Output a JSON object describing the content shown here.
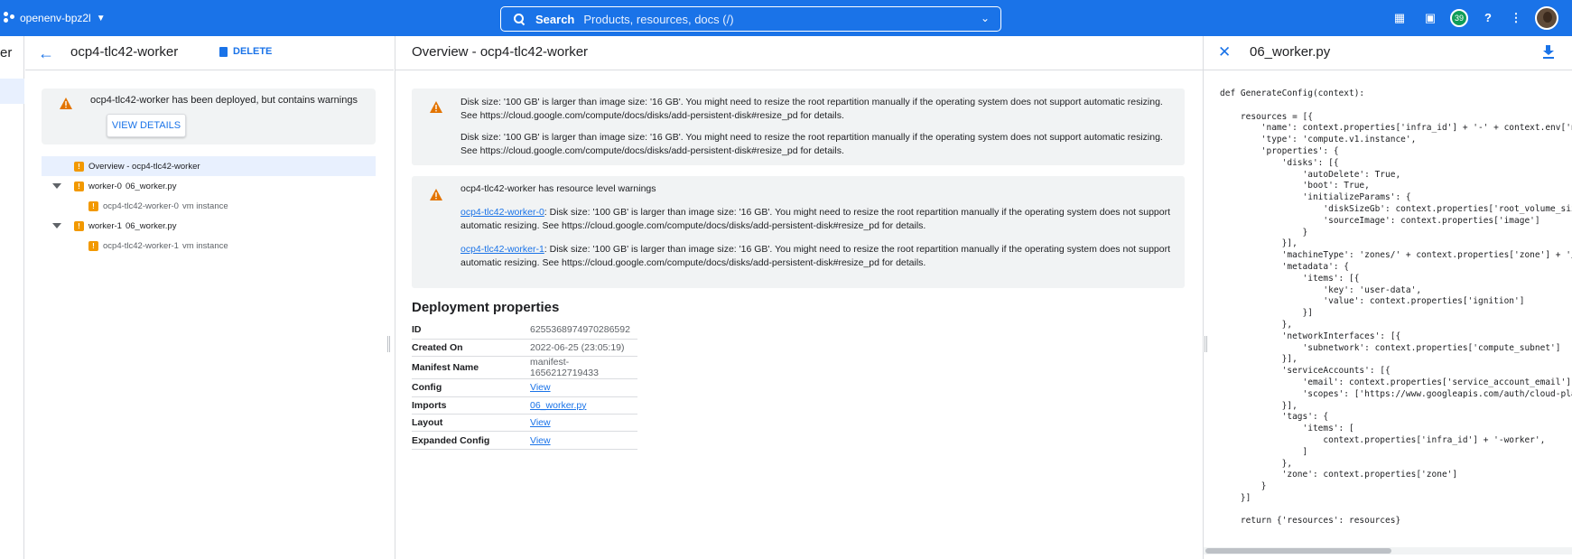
{
  "topbar": {
    "project": "openenv-bpz2l",
    "search_label": "Search",
    "search_placeholder": "Products, resources, docs (/)",
    "notifications_count": "39"
  },
  "strip": {
    "text": "er"
  },
  "left": {
    "title": "ocp4-tlc42-worker",
    "delete_label": "DELETE",
    "warning_text": "ocp4-tlc42-worker has been deployed, but contains warnings",
    "view_details_label": "VIEW DETAILS",
    "tree": [
      {
        "label": "Overview - ocp4-tlc42-worker",
        "sub": ""
      },
      {
        "label": "worker-0",
        "sub": "06_worker.py"
      },
      {
        "label": "ocp4-tlc42-worker-0",
        "sub": "vm instance"
      },
      {
        "label": "worker-1",
        "sub": "06_worker.py"
      },
      {
        "label": "ocp4-tlc42-worker-1",
        "sub": "vm instance"
      }
    ]
  },
  "mid": {
    "title": "Overview - ocp4-tlc42-worker",
    "card1": [
      "Disk size: '100 GB' is larger than image size: '16 GB'. You might need to resize the root repartition manually if the operating system does not support automatic resizing. See https://cloud.google.com/compute/docs/disks/add-persistent-disk#resize_pd for details.",
      "Disk size: '100 GB' is larger than image size: '16 GB'. You might need to resize the root repartition manually if the operating system does not support automatic resizing. See https://cloud.google.com/compute/docs/disks/add-persistent-disk#resize_pd for details."
    ],
    "card2_title": "ocp4-tlc42-worker has resource level warnings",
    "card2_items": [
      {
        "link": "ocp4-tlc42-worker-0",
        "text": ": Disk size: '100 GB' is larger than image size: '16 GB'. You might need to resize the root repartition manually if the operating system does not support automatic resizing. See https://cloud.google.com/compute/docs/disks/add-persistent-disk#resize_pd for details."
      },
      {
        "link": "ocp4-tlc42-worker-1",
        "text": ": Disk size: '100 GB' is larger than image size: '16 GB'. You might need to resize the root repartition manually if the operating system does not support automatic resizing. See https://cloud.google.com/compute/docs/disks/add-persistent-disk#resize_pd for details."
      }
    ],
    "props_title": "Deployment properties",
    "props": [
      {
        "key": "ID",
        "value": "6255368974970286592",
        "link": false
      },
      {
        "key": "Created On",
        "value": "2022-06-25 (23:05:19)",
        "link": false
      },
      {
        "key": "Manifest Name",
        "value": "manifest-1656212719433",
        "link": false
      },
      {
        "key": "Config",
        "value": "View",
        "link": true
      },
      {
        "key": "Imports",
        "value": "06_worker.py",
        "link": true
      },
      {
        "key": "Layout",
        "value": "View",
        "link": true
      },
      {
        "key": "Expanded Config",
        "value": "View",
        "link": true
      }
    ]
  },
  "right": {
    "title": "06_worker.py",
    "code": "def GenerateConfig(context):\n\n    resources = [{\n        'name': context.properties['infra_id'] + '-' + context.env['name'],\n        'type': 'compute.v1.instance',\n        'properties': {\n            'disks': [{\n                'autoDelete': True,\n                'boot': True,\n                'initializeParams': {\n                    'diskSizeGb': context.properties['root_volume_size'],\n                    'sourceImage': context.properties['image']\n                }\n            }],\n            'machineType': 'zones/' + context.properties['zone'] + '/machineTypes/',\n            'metadata': {\n                'items': [{\n                    'key': 'user-data',\n                    'value': context.properties['ignition']\n                }]\n            },\n            'networkInterfaces': [{\n                'subnetwork': context.properties['compute_subnet']\n            }],\n            'serviceAccounts': [{\n                'email': context.properties['service_account_email'],\n                'scopes': ['https://www.googleapis.com/auth/cloud-platform']\n            }],\n            'tags': {\n                'items': [\n                    context.properties['infra_id'] + '-worker',\n                ]\n            },\n            'zone': context.properties['zone']\n        }\n    }]\n\n    return {'resources': resources}"
  },
  "colors": {
    "accent": "#1a73e8",
    "warning": "#f29900",
    "panel_bg": "#f1f3f4"
  },
  "icons": [
    "project-icon",
    "search-icon",
    "gift-icon",
    "terminal-icon",
    "help-icon",
    "more-vert-icon",
    "back-arrow-icon",
    "trash-icon",
    "warning-icon",
    "close-icon",
    "download-icon"
  ]
}
